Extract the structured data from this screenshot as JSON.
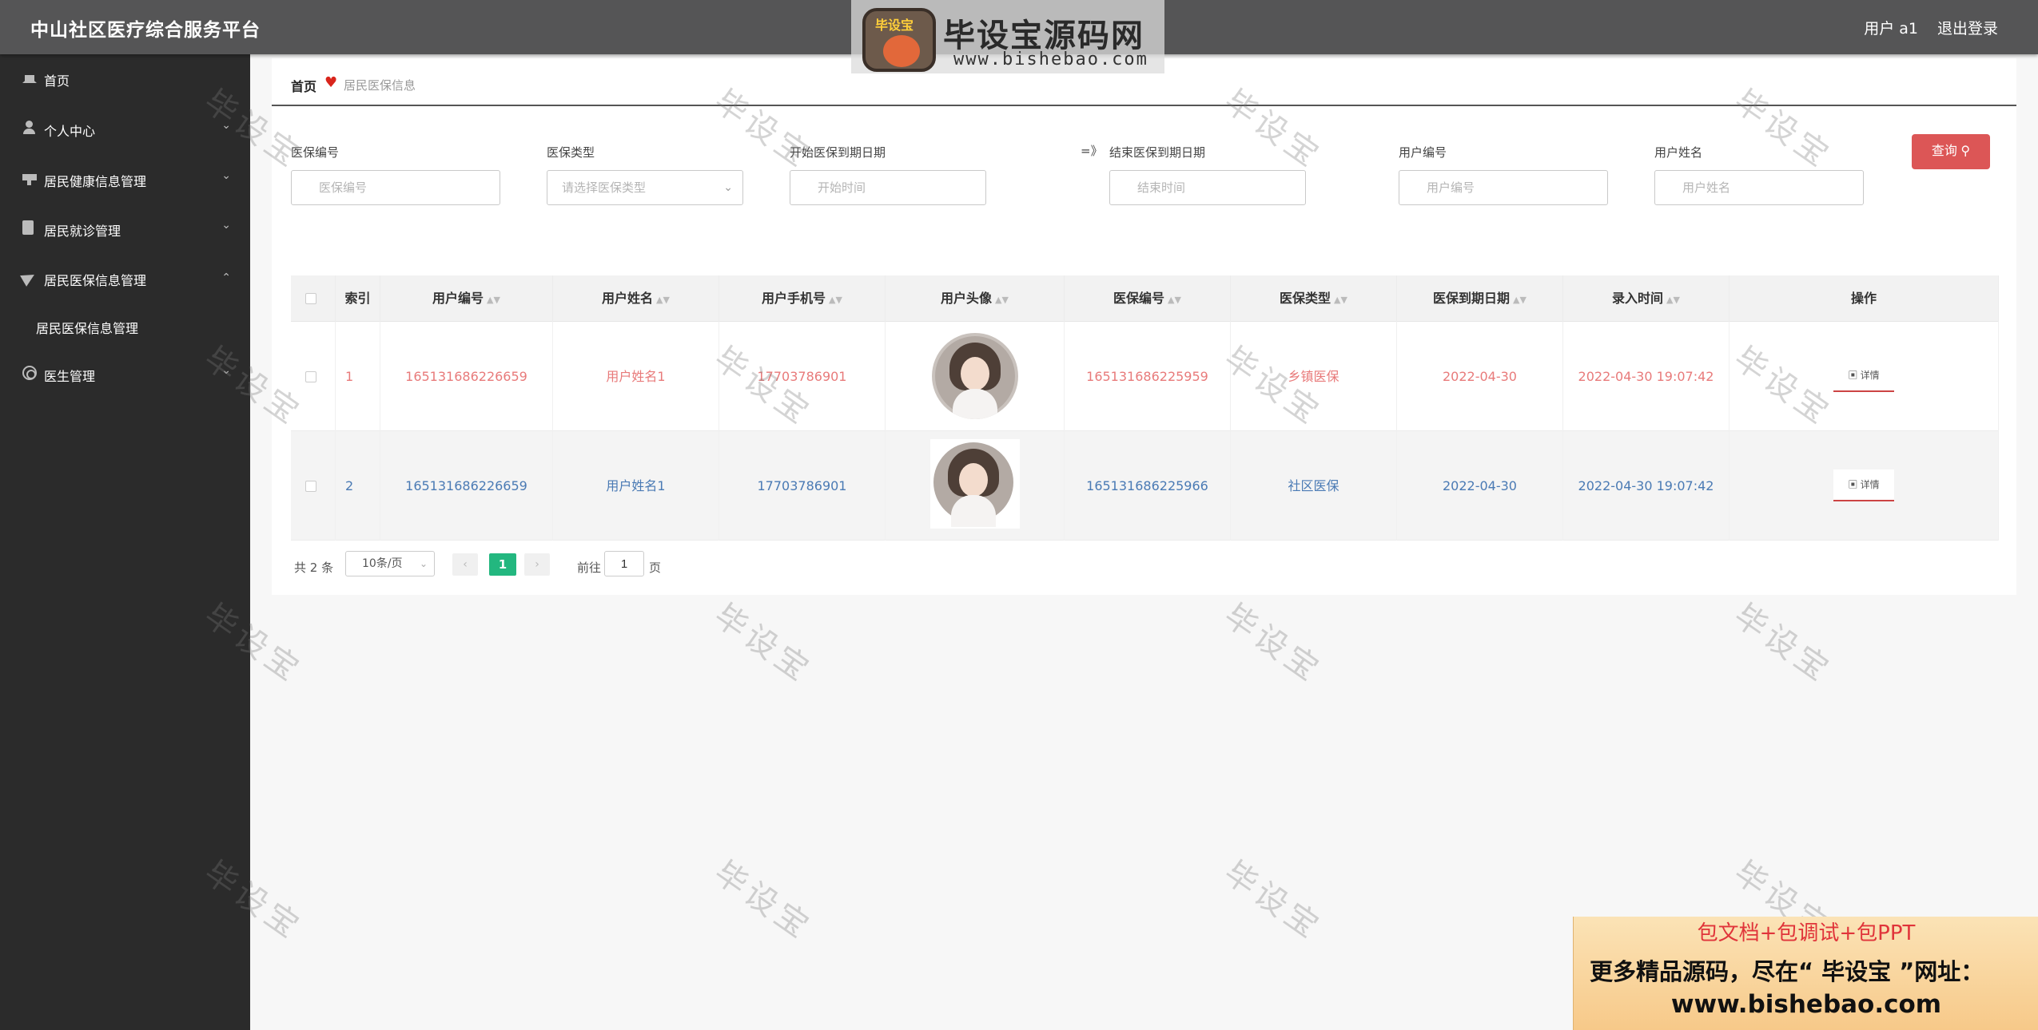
{
  "header": {
    "app_title": "中山社区医疗综合服务平台",
    "user_label": "用户 a1",
    "logout_label": "退出登录"
  },
  "watermark_logo": {
    "badge_text": "毕设宝",
    "brand": "毕设宝源码网",
    "url": "www.bishebao.com"
  },
  "sidebar": {
    "items": [
      {
        "label": "首页",
        "icon": "home-icon"
      },
      {
        "label": "个人中心",
        "icon": "user-icon"
      },
      {
        "label": "居民健康信息管理",
        "icon": "health-icon"
      },
      {
        "label": "居民就诊管理",
        "icon": "clipboard-icon"
      },
      {
        "label": "居民医保信息管理",
        "icon": "send-icon"
      },
      {
        "label": "医生管理",
        "icon": "doctor-icon"
      }
    ],
    "sub_item": "居民医保信息管理"
  },
  "breadcrumb": {
    "home": "首页",
    "current": "居民医保信息"
  },
  "filters": {
    "insurance_no_label": "医保编号",
    "insurance_no_placeholder": "医保编号",
    "insurance_type_label": "医保类型",
    "insurance_type_placeholder": "请选择医保类型",
    "start_date_label": "开始医保到期日期",
    "start_date_placeholder": "开始时间",
    "separator": "=》",
    "end_date_label": "结束医保到期日期",
    "end_date_placeholder": "结束时间",
    "user_no_label": "用户编号",
    "user_no_placeholder": "用户编号",
    "user_name_label": "用户姓名",
    "user_name_placeholder": "用户姓名",
    "search_button": "查询"
  },
  "table": {
    "columns": [
      "索引",
      "用户编号",
      "用户姓名",
      "用户手机号",
      "用户头像",
      "医保编号",
      "医保类型",
      "医保到期日期",
      "录入时间",
      "操作"
    ],
    "rows": [
      {
        "index": "1",
        "user_no": "165131686226659",
        "user_name": "用户姓名1",
        "phone": "17703786901",
        "insurance_no": "165131686225959",
        "insurance_type": "乡镇医保",
        "expiry_date": "2022-04-30",
        "created_at": "2022-04-30 19:07:42",
        "action": "详情"
      },
      {
        "index": "2",
        "user_no": "165131686226659",
        "user_name": "用户姓名1",
        "phone": "17703786901",
        "insurance_no": "165131686225966",
        "insurance_type": "社区医保",
        "expiry_date": "2022-04-30",
        "created_at": "2022-04-30 19:07:42",
        "action": "详情"
      }
    ]
  },
  "pagination": {
    "total": "共 2 条",
    "page_size": "10条/页",
    "current_page": "1",
    "goto_label": "前往",
    "goto_value": "1",
    "page_suffix": "页"
  },
  "watermark_text": "毕设宝",
  "ad": {
    "line1": "包文档+包调试+包PPT",
    "line2": "更多精品源码，尽在“ 毕设宝 ”网址：",
    "line3": "www.bishebao.com"
  }
}
